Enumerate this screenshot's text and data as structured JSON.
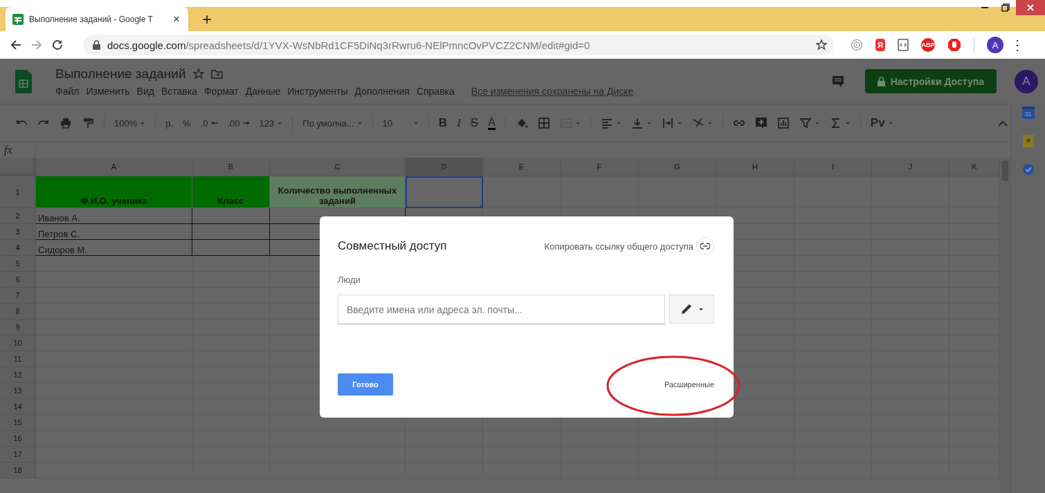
{
  "browser": {
    "tab": {
      "title": "Выполнение заданий - Google T",
      "close": "×"
    },
    "new_tab": "+",
    "url_host": "docs.google.com",
    "url_path": "/spreadsheets/d/1YVX-WsNbRd1CF5DiNq3rRwru6-NElPmncOvPVCZ2CNM/edit#gid=0",
    "extension_labels": {
      "yandex": "Я",
      "adblock": "ABP"
    },
    "avatar": "A",
    "menu": "⋮"
  },
  "doc": {
    "title": "Выполнение заданий",
    "menus": [
      "Файл",
      "Изменить",
      "Вид",
      "Вставка",
      "Формат",
      "Данные",
      "Инструменты",
      "Дополнения",
      "Справка"
    ],
    "save_status": "Все изменения сохранены на Диске",
    "share_button": "Настройки Доступа",
    "avatar": "A"
  },
  "toolbar": {
    "zoom": "100%",
    "currency": "р.",
    "percent": "%",
    "decimal_less": ".0",
    "decimal_more": ".00",
    "number_format": "123",
    "font": "По умолча...",
    "font_size": "10",
    "bold": "B",
    "italic": "I",
    "strike": "S",
    "text_color": "A",
    "input_tools": "Рv"
  },
  "formula_bar": {
    "label": "fx"
  },
  "side_panel": {
    "calendar_day": "31"
  },
  "sheet": {
    "columns": [
      "A",
      "B",
      "C",
      "D",
      "E",
      "F",
      "G",
      "H",
      "I",
      "J",
      "K"
    ],
    "rows": [
      {
        "number": "1",
        "cells": [
          {
            "text": "Ф.И.О. ученика",
            "color": "#006b00",
            "bordered": false,
            "selected": false
          },
          {
            "text": "Класс",
            "color": "#006b00",
            "bordered": false,
            "selected": false
          },
          {
            "text": "Количество выполненных заданий",
            "color": "#5e7c60",
            "bordered": false,
            "selected": false
          },
          {
            "selected": true
          }
        ]
      },
      {
        "number": "2",
        "cells": [
          {
            "text": "Иванов А.",
            "bordered": true,
            "selected": false
          },
          {
            "bordered": true,
            "selected": false
          },
          {
            "bordered": true,
            "selected": false
          }
        ]
      },
      {
        "number": "3",
        "cells": [
          {
            "text": "Петров С.",
            "bordered": true,
            "selected": false
          },
          {
            "bordered": true,
            "selected": false
          },
          {
            "bordered": true,
            "selected": false
          }
        ]
      },
      {
        "number": "4",
        "cells": [
          {
            "text": "Сидоров М.",
            "bordered": true,
            "selected": false
          },
          {
            "bordered": true,
            "selected": false
          },
          {
            "bordered": true,
            "selected": false
          }
        ]
      },
      {
        "number": "5"
      },
      {
        "number": "6"
      },
      {
        "number": "7"
      },
      {
        "number": "8"
      },
      {
        "number": "9"
      },
      {
        "number": "10"
      },
      {
        "number": "11"
      },
      {
        "number": "12"
      },
      {
        "number": "13"
      },
      {
        "number": "14"
      },
      {
        "number": "15"
      },
      {
        "number": "16"
      },
      {
        "number": "17"
      },
      {
        "number": "18"
      }
    ]
  },
  "dialog": {
    "title": "Совместный доступ",
    "copy_link": "Копировать ссылку общего доступа",
    "people_label": "Люди",
    "people_input": {
      "placeholder": "Введите имена или адреса эл. почты..."
    },
    "done_button": "Готово",
    "advanced_link": "Расширенные",
    "advanced_highlighted": true
  }
}
